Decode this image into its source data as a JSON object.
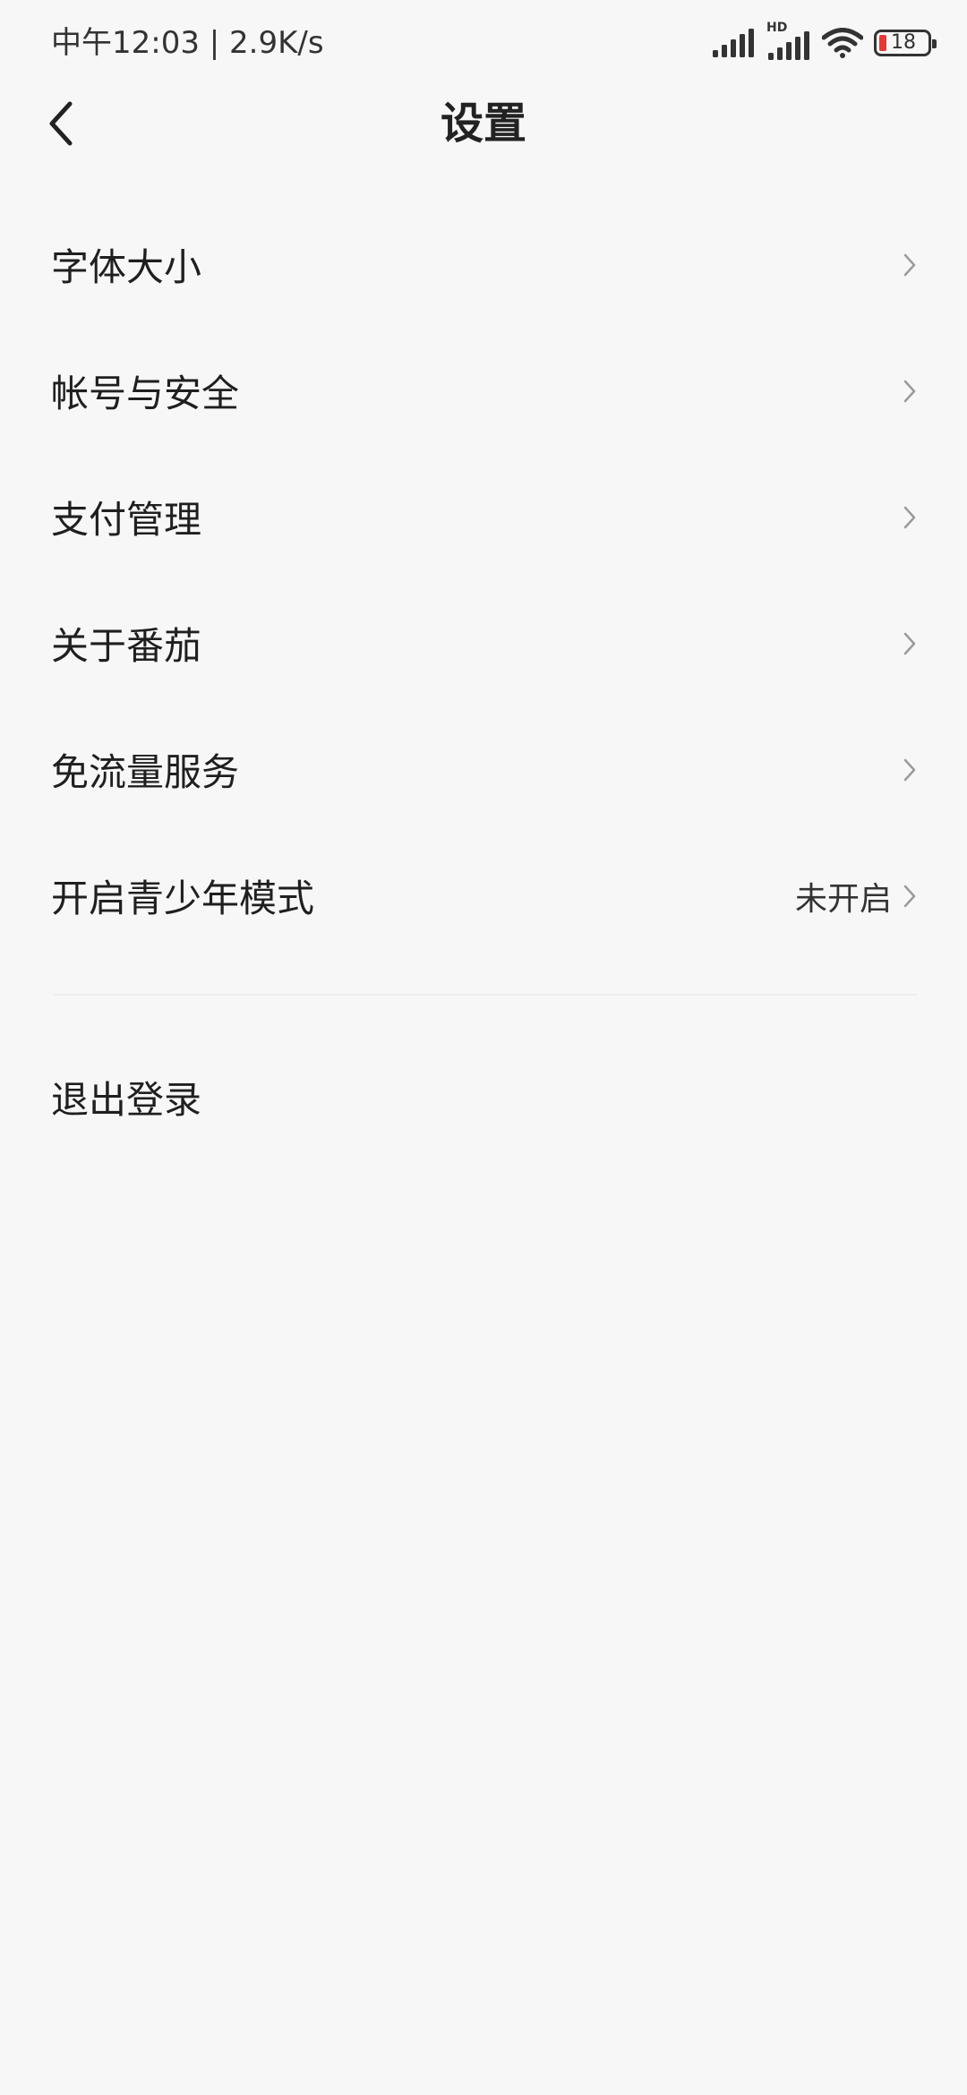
{
  "status_bar": {
    "time_speed": "中午12:03 | 2.9K/s",
    "network_badge": "HD",
    "battery_level": "18",
    "battery_color": "#e53935",
    "icons": [
      "signal-icon",
      "hd-signal-icon",
      "wifi-icon",
      "battery-icon"
    ]
  },
  "header": {
    "title": "设置",
    "back_icon": "chevron-left-icon"
  },
  "settings": {
    "items": [
      {
        "label": "字体大小"
      },
      {
        "label": "帐号与安全"
      },
      {
        "label": "支付管理"
      },
      {
        "label": "关于番茄"
      },
      {
        "label": "免流量服务"
      },
      {
        "label": "开启青少年模式",
        "value": "未开启"
      }
    ]
  },
  "logout": {
    "label": "退出登录"
  }
}
